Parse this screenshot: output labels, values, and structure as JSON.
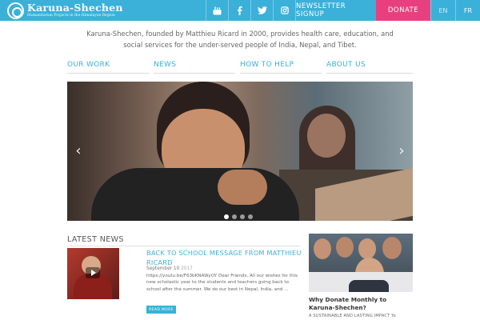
{
  "header": {
    "logo_name": "Karuna-Shechen",
    "logo_tagline": "Humanitarian Projects in the Himalayan Region",
    "social": [
      {
        "icon": "youtube-icon"
      },
      {
        "icon": "facebook-icon"
      },
      {
        "icon": "twitter-icon"
      },
      {
        "icon": "instagram-icon"
      }
    ],
    "newsletter_label": "NEWSLETTER SIGNUP",
    "donate_label": "DONATE",
    "languages": [
      "EN",
      "FR"
    ],
    "active_language": "FR"
  },
  "intro": {
    "text": "Karuna-Shechen, founded by Matthieu Ricard in 2000, provides health care, education, and social services for the under-served people of India, Nepal, and Tibet."
  },
  "nav": {
    "items": [
      "OUR WORK",
      "NEWS",
      "HOW TO HELP",
      "ABOUT US"
    ]
  },
  "slider": {
    "prev_label": "‹",
    "next_label": "›",
    "slide_count": 4,
    "active_slide": 1
  },
  "latest_news": {
    "heading": "LATEST NEWS",
    "item": {
      "title": "BACK TO SCHOOL MESSAGE FROM MATTHIEU RICARD",
      "date": "September 10",
      "year": "2017",
      "excerpt": "https://youtu.be/F63bKNAWyOY Dear Friends, All our wishes for this new scholastic year to the students and teachers going back to school after the summer. We do our best in Nepal, India, and …",
      "read_more": "READ MORE"
    }
  },
  "side_story": {
    "title": "Why Donate Monthly to Karuna-Shechen?",
    "subtitle": "A SUSTAINABLE AND LASTING IMPACT Yo"
  },
  "colors": {
    "brand_blue": "#3bb0d9",
    "donate_pink": "#e8407e"
  }
}
